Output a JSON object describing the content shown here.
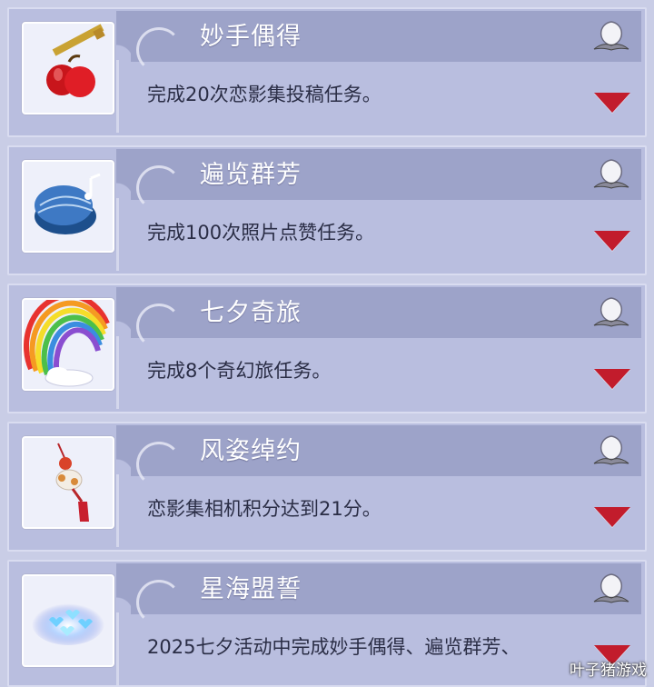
{
  "achievements": [
    {
      "title": "妙手偶得",
      "desc": "完成20次恋影集投稿任务。",
      "icon": "apple-hairpin-icon"
    },
    {
      "title": "遍览群芳",
      "desc": "完成100次照片点赞任务。",
      "icon": "blue-shell-icon"
    },
    {
      "title": "七夕奇旅",
      "desc": "完成8个奇幻旅任务。",
      "icon": "rainbow-icon"
    },
    {
      "title": "风姿绰约",
      "desc": "恋影集相机积分达到21分。",
      "icon": "tassel-ornament-icon"
    },
    {
      "title": "星海盟誓",
      "desc": "2025七夕活动中完成妙手偶得、遍览群芳、",
      "icon": "heart-stars-icon"
    }
  ],
  "watermark": "叶子猪游戏",
  "colors": {
    "card_bg": "#b9bedf",
    "header_bg": "#9da3c9",
    "arrow": "#c21c2c"
  }
}
